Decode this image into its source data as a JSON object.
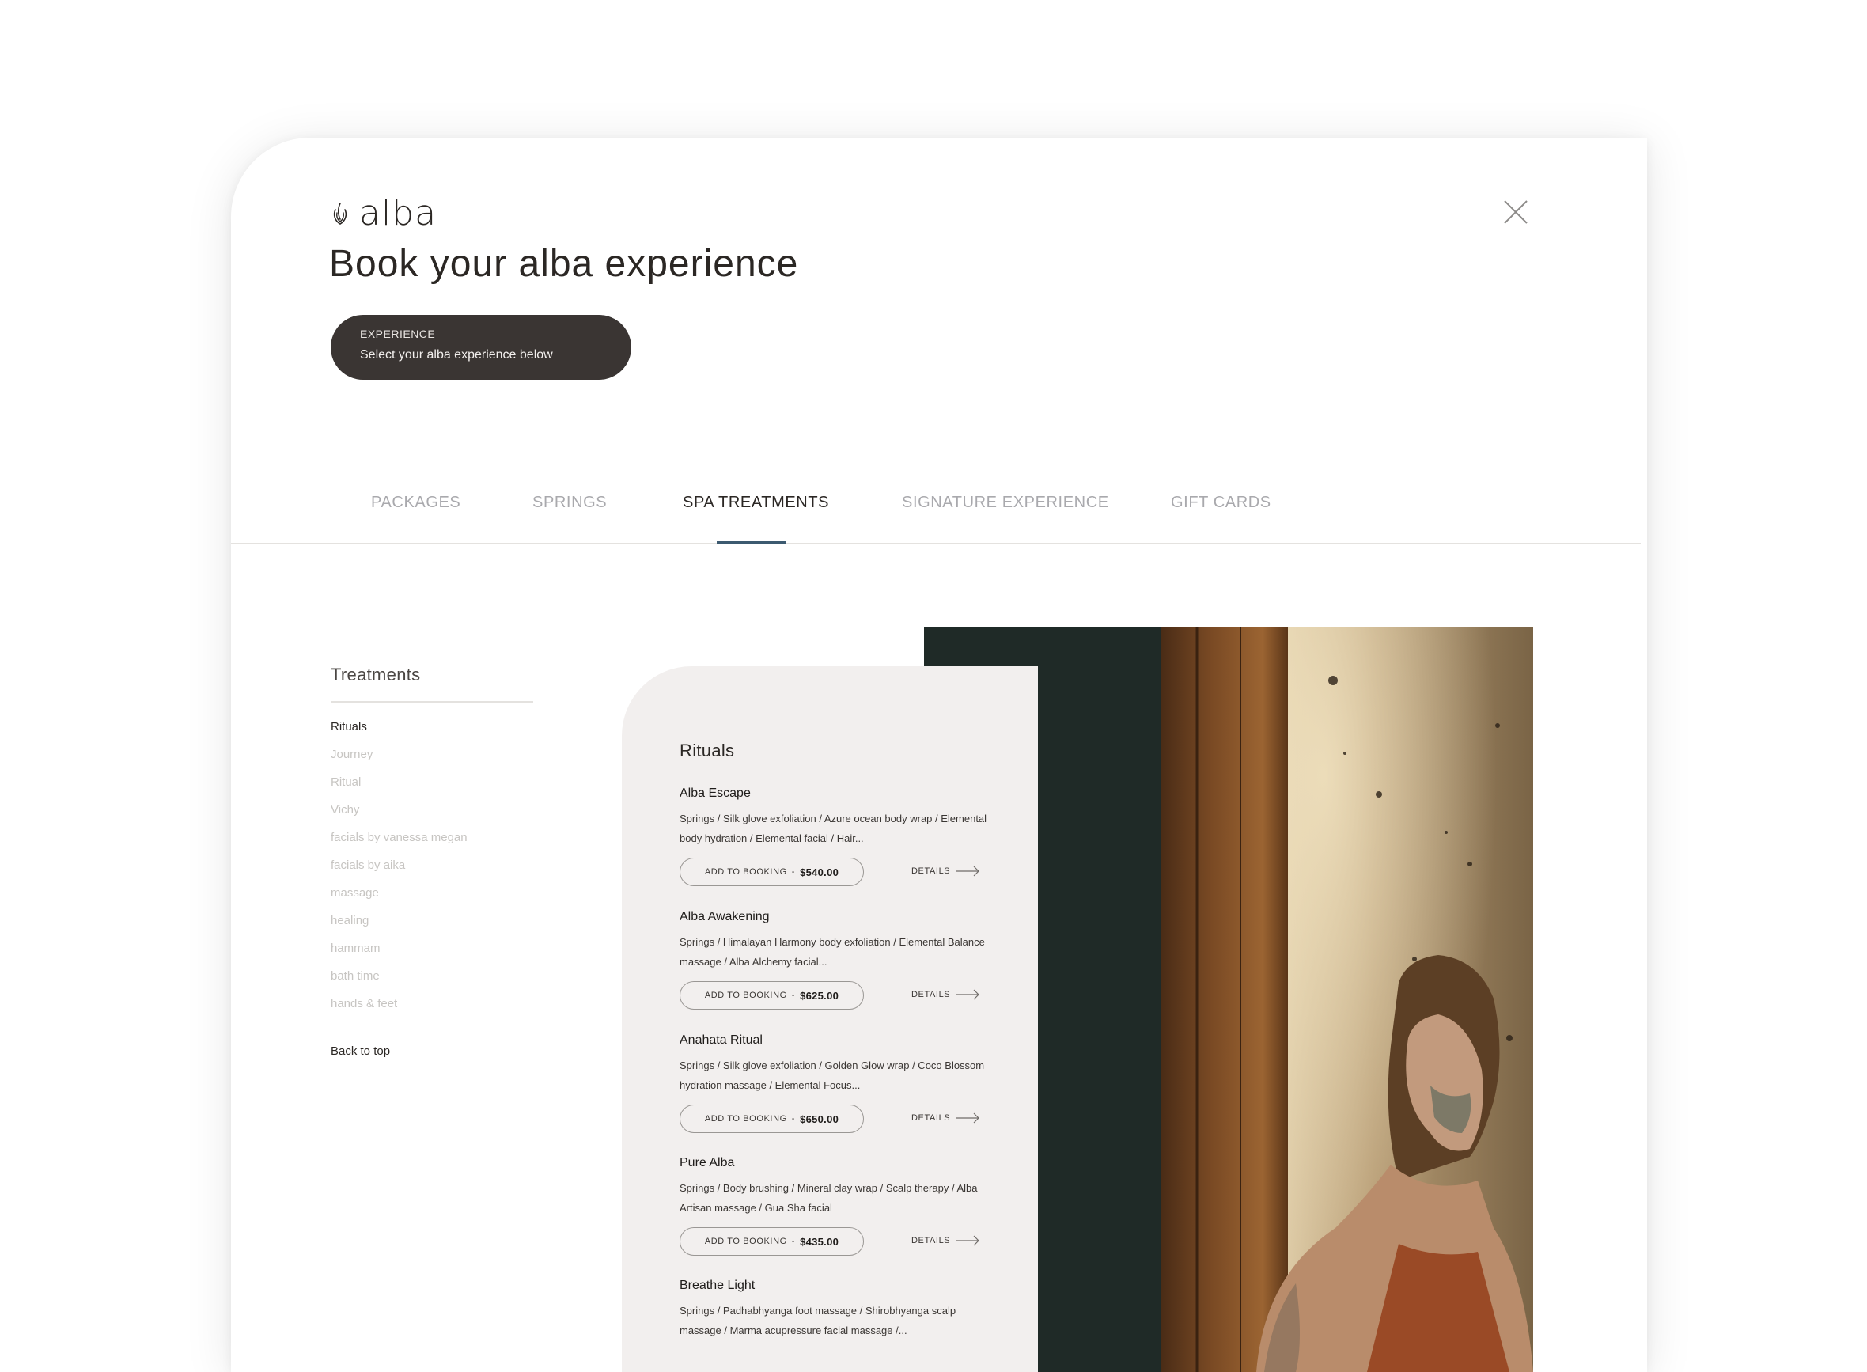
{
  "brand": {
    "name": "alba"
  },
  "header": {
    "title": "Book your alba experience",
    "experience": {
      "label": "EXPERIENCE",
      "value": "Select your alba experience below"
    }
  },
  "tabs": [
    {
      "label": "PACKAGES",
      "active": false
    },
    {
      "label": "SPRINGS",
      "active": false
    },
    {
      "label": "SPA TREATMENTS",
      "active": true
    },
    {
      "label": "SIGNATURE EXPERIENCE",
      "active": false
    },
    {
      "label": "GIFT CARDS",
      "active": false
    }
  ],
  "sidebar": {
    "title": "Treatments",
    "items": [
      {
        "label": "Rituals",
        "active": true
      },
      {
        "label": "Journey"
      },
      {
        "label": "Ritual"
      },
      {
        "label": "Vichy"
      },
      {
        "label": "facials by vanessa megan"
      },
      {
        "label": "facials by aika"
      },
      {
        "label": "massage"
      },
      {
        "label": "healing"
      },
      {
        "label": "hammam"
      },
      {
        "label": "bath time"
      },
      {
        "label": "hands & feet"
      }
    ],
    "back_to_top": "Back to top"
  },
  "section": {
    "title": "Rituals",
    "add_label": "ADD TO BOOKING",
    "separator": "-",
    "details_label": "DETAILS",
    "items": [
      {
        "name": "Alba Escape",
        "description": "Springs / Silk glove exfoliation / Azure ocean body wrap / Elemental body hydration / Elemental facial / Hair...",
        "price": "$540.00"
      },
      {
        "name": "Alba Awakening",
        "description": "Springs / Himalayan Harmony body exfoliation / Elemental Balance massage / Alba Alchemy facial...",
        "price": "$625.00"
      },
      {
        "name": "Anahata Ritual",
        "description": "Springs / Silk glove exfoliation / Golden Glow wrap / Coco Blossom hydration massage / Elemental Focus...",
        "price": "$650.00"
      },
      {
        "name": "Pure Alba",
        "description": "Springs / Body brushing / Mineral clay wrap / Scalp therapy / Alba Artisan massage / Gua Sha facial",
        "price": "$435.00"
      },
      {
        "name": "Breathe Light",
        "description": "Springs / Padhabhyanga foot massage / Shirobhyanga scalp massage / Marma acupressure facial massage /...",
        "price": ""
      }
    ]
  },
  "icons": {
    "brand": "flame-logo-icon",
    "close": "close-icon",
    "details": "arrow-right-icon"
  },
  "colors": {
    "accent": "#3c5a70",
    "pill": "#3a3533",
    "card": "#f2efee",
    "muted": "#a9a9ad"
  }
}
